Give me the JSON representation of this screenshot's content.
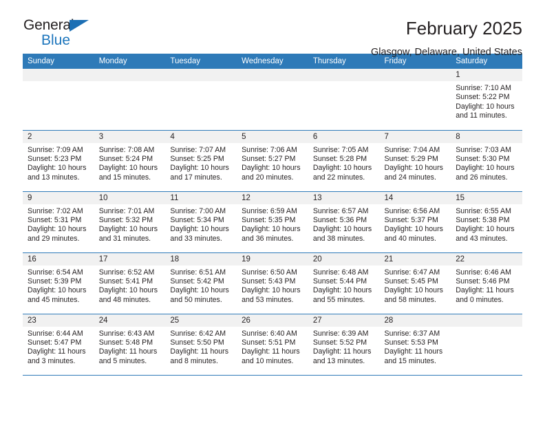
{
  "brand": {
    "name_part1": "General",
    "name_part2": "Blue",
    "triangle_icon": "triangle-icon",
    "colors": {
      "accent": "#1c75bc",
      "header": "#2e7ab8",
      "dark": "#231f20"
    }
  },
  "header": {
    "title": "February 2025",
    "location": "Glasgow, Delaware, United States"
  },
  "calendar": {
    "weekdays": [
      "Sunday",
      "Monday",
      "Tuesday",
      "Wednesday",
      "Thursday",
      "Friday",
      "Saturday"
    ],
    "weeks": [
      [
        {
          "empty": true,
          "day": ""
        },
        {
          "empty": true,
          "day": ""
        },
        {
          "empty": true,
          "day": ""
        },
        {
          "empty": true,
          "day": ""
        },
        {
          "empty": true,
          "day": ""
        },
        {
          "empty": true,
          "day": ""
        },
        {
          "day": "1",
          "sunrise": "Sunrise: 7:10 AM",
          "sunset": "Sunset: 5:22 PM",
          "daylight": "Daylight: 10 hours and 11 minutes."
        }
      ],
      [
        {
          "day": "2",
          "sunrise": "Sunrise: 7:09 AM",
          "sunset": "Sunset: 5:23 PM",
          "daylight": "Daylight: 10 hours and 13 minutes."
        },
        {
          "day": "3",
          "sunrise": "Sunrise: 7:08 AM",
          "sunset": "Sunset: 5:24 PM",
          "daylight": "Daylight: 10 hours and 15 minutes."
        },
        {
          "day": "4",
          "sunrise": "Sunrise: 7:07 AM",
          "sunset": "Sunset: 5:25 PM",
          "daylight": "Daylight: 10 hours and 17 minutes."
        },
        {
          "day": "5",
          "sunrise": "Sunrise: 7:06 AM",
          "sunset": "Sunset: 5:27 PM",
          "daylight": "Daylight: 10 hours and 20 minutes."
        },
        {
          "day": "6",
          "sunrise": "Sunrise: 7:05 AM",
          "sunset": "Sunset: 5:28 PM",
          "daylight": "Daylight: 10 hours and 22 minutes."
        },
        {
          "day": "7",
          "sunrise": "Sunrise: 7:04 AM",
          "sunset": "Sunset: 5:29 PM",
          "daylight": "Daylight: 10 hours and 24 minutes."
        },
        {
          "day": "8",
          "sunrise": "Sunrise: 7:03 AM",
          "sunset": "Sunset: 5:30 PM",
          "daylight": "Daylight: 10 hours and 26 minutes."
        }
      ],
      [
        {
          "day": "9",
          "sunrise": "Sunrise: 7:02 AM",
          "sunset": "Sunset: 5:31 PM",
          "daylight": "Daylight: 10 hours and 29 minutes."
        },
        {
          "day": "10",
          "sunrise": "Sunrise: 7:01 AM",
          "sunset": "Sunset: 5:32 PM",
          "daylight": "Daylight: 10 hours and 31 minutes."
        },
        {
          "day": "11",
          "sunrise": "Sunrise: 7:00 AM",
          "sunset": "Sunset: 5:34 PM",
          "daylight": "Daylight: 10 hours and 33 minutes."
        },
        {
          "day": "12",
          "sunrise": "Sunrise: 6:59 AM",
          "sunset": "Sunset: 5:35 PM",
          "daylight": "Daylight: 10 hours and 36 minutes."
        },
        {
          "day": "13",
          "sunrise": "Sunrise: 6:57 AM",
          "sunset": "Sunset: 5:36 PM",
          "daylight": "Daylight: 10 hours and 38 minutes."
        },
        {
          "day": "14",
          "sunrise": "Sunrise: 6:56 AM",
          "sunset": "Sunset: 5:37 PM",
          "daylight": "Daylight: 10 hours and 40 minutes."
        },
        {
          "day": "15",
          "sunrise": "Sunrise: 6:55 AM",
          "sunset": "Sunset: 5:38 PM",
          "daylight": "Daylight: 10 hours and 43 minutes."
        }
      ],
      [
        {
          "day": "16",
          "sunrise": "Sunrise: 6:54 AM",
          "sunset": "Sunset: 5:39 PM",
          "daylight": "Daylight: 10 hours and 45 minutes."
        },
        {
          "day": "17",
          "sunrise": "Sunrise: 6:52 AM",
          "sunset": "Sunset: 5:41 PM",
          "daylight": "Daylight: 10 hours and 48 minutes."
        },
        {
          "day": "18",
          "sunrise": "Sunrise: 6:51 AM",
          "sunset": "Sunset: 5:42 PM",
          "daylight": "Daylight: 10 hours and 50 minutes."
        },
        {
          "day": "19",
          "sunrise": "Sunrise: 6:50 AM",
          "sunset": "Sunset: 5:43 PM",
          "daylight": "Daylight: 10 hours and 53 minutes."
        },
        {
          "day": "20",
          "sunrise": "Sunrise: 6:48 AM",
          "sunset": "Sunset: 5:44 PM",
          "daylight": "Daylight: 10 hours and 55 minutes."
        },
        {
          "day": "21",
          "sunrise": "Sunrise: 6:47 AM",
          "sunset": "Sunset: 5:45 PM",
          "daylight": "Daylight: 10 hours and 58 minutes."
        },
        {
          "day": "22",
          "sunrise": "Sunrise: 6:46 AM",
          "sunset": "Sunset: 5:46 PM",
          "daylight": "Daylight: 11 hours and 0 minutes."
        }
      ],
      [
        {
          "day": "23",
          "sunrise": "Sunrise: 6:44 AM",
          "sunset": "Sunset: 5:47 PM",
          "daylight": "Daylight: 11 hours and 3 minutes."
        },
        {
          "day": "24",
          "sunrise": "Sunrise: 6:43 AM",
          "sunset": "Sunset: 5:48 PM",
          "daylight": "Daylight: 11 hours and 5 minutes."
        },
        {
          "day": "25",
          "sunrise": "Sunrise: 6:42 AM",
          "sunset": "Sunset: 5:50 PM",
          "daylight": "Daylight: 11 hours and 8 minutes."
        },
        {
          "day": "26",
          "sunrise": "Sunrise: 6:40 AM",
          "sunset": "Sunset: 5:51 PM",
          "daylight": "Daylight: 11 hours and 10 minutes."
        },
        {
          "day": "27",
          "sunrise": "Sunrise: 6:39 AM",
          "sunset": "Sunset: 5:52 PM",
          "daylight": "Daylight: 11 hours and 13 minutes."
        },
        {
          "day": "28",
          "sunrise": "Sunrise: 6:37 AM",
          "sunset": "Sunset: 5:53 PM",
          "daylight": "Daylight: 11 hours and 15 minutes."
        },
        {
          "empty": true,
          "day": ""
        }
      ]
    ]
  }
}
